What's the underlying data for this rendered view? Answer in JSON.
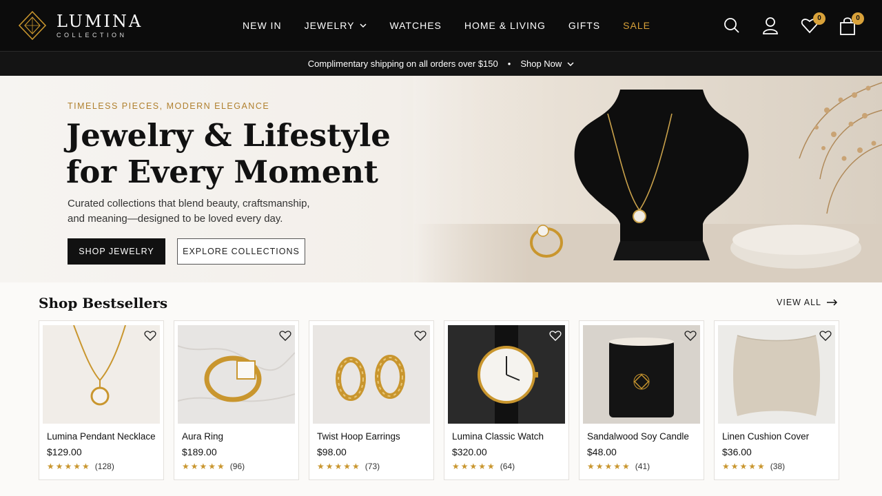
{
  "brand": {
    "name": "LUMINA",
    "sub": "COLLECTION"
  },
  "nav": [
    {
      "label": "NEW IN"
    },
    {
      "label": "JEWELRY",
      "dropdown": true
    },
    {
      "label": "WATCHES"
    },
    {
      "label": "HOME & LIVING"
    },
    {
      "label": "GIFTS"
    },
    {
      "label": "SALE",
      "accent": true
    }
  ],
  "header_icons": {
    "search": "search-icon",
    "account": "user-icon",
    "wishlist": {
      "icon": "heart-icon",
      "count": "0"
    },
    "cart": {
      "icon": "shopping-bag-icon",
      "count": "0"
    }
  },
  "promo": {
    "text": "Complimentary shipping on all orders over $150",
    "separator": "•",
    "link": "Shop Now"
  },
  "hero": {
    "eyebrow": "TIMELESS PIECES, MODERN ELEGANCE",
    "title_line1": "Jewelry & Lifestyle",
    "title_line2": "for Every Moment",
    "desc_line1": "Curated collections that blend beauty, craftsmanship,",
    "desc_line2": "and meaning—designed to be loved every day.",
    "primary_cta": "SHOP JEWELRY",
    "secondary_cta": "EXPLORE COLLECTIONS"
  },
  "bestsellers": {
    "title": "Shop Bestsellers",
    "view_all": "VIEW ALL",
    "products": [
      {
        "name": "Lumina Pendant Necklace",
        "price": "$129.00",
        "stars": "★★★★★",
        "reviews": "(128)",
        "image": "necklace"
      },
      {
        "name": "Aura Ring",
        "price": "$189.00",
        "stars": "★★★★★",
        "reviews": "(96)",
        "image": "ring"
      },
      {
        "name": "Twist Hoop Earrings",
        "price": "$98.00",
        "stars": "★★★★★",
        "reviews": "(73)",
        "image": "earrings"
      },
      {
        "name": "Lumina Classic Watch",
        "price": "$320.00",
        "stars": "★★★★★",
        "reviews": "(64)",
        "image": "watch"
      },
      {
        "name": "Sandalwood Soy Candle",
        "price": "$48.00",
        "stars": "★★★★★",
        "reviews": "(41)",
        "image": "candle"
      },
      {
        "name": "Linen Cushion Cover",
        "price": "$36.00",
        "stars": "★★★★★",
        "reviews": "(38)",
        "image": "cushion"
      }
    ]
  },
  "colors": {
    "accent": "#d9a23a",
    "header_bg": "#0c0c0c",
    "star": "#c9962e"
  }
}
